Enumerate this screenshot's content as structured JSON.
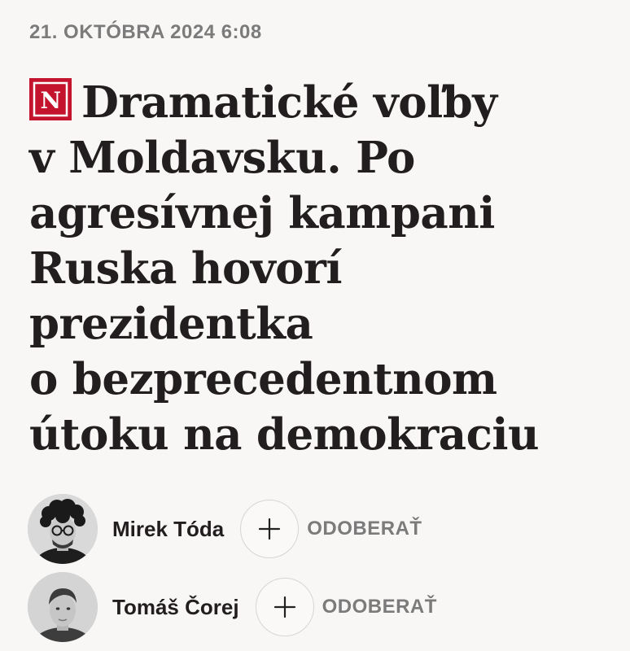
{
  "article": {
    "date": "21. OKTÓBRA 2024 6:08",
    "logo_letter": "N",
    "headline_lines": [
      "Dramatické voľby",
      "v Moldavsku. Po",
      "agresívnej kampani",
      "Ruska hovorí",
      "prezidentka",
      "o bezprecedentnom",
      "útoku na demokraciu"
    ]
  },
  "authors": [
    {
      "name": "Mirek Tóda",
      "follow_icon": "plus-icon",
      "follow_label": "ODOBERAŤ"
    },
    {
      "name": "Tomáš Čorej",
      "follow_icon": "plus-icon",
      "follow_label": "ODOBERAŤ"
    }
  ],
  "colors": {
    "background": "#f8f7f6",
    "headline": "#221e1f",
    "muted": "#7b7b7b",
    "brand_red": "#c3132d"
  }
}
